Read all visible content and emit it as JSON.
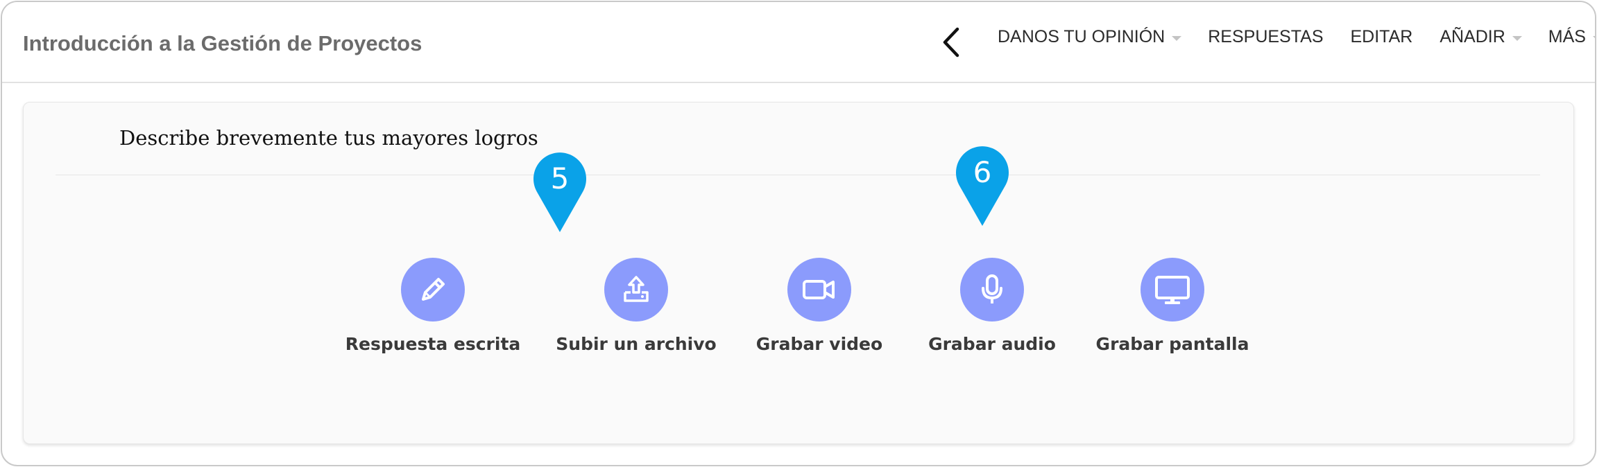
{
  "header": {
    "title": "Introducción a la Gestión de Proyectos",
    "nav": [
      {
        "label": "DANOS TU OPINIÓN",
        "has_dropdown": true
      },
      {
        "label": "RESPUESTAS",
        "has_dropdown": false
      },
      {
        "label": "EDITAR",
        "has_dropdown": false
      },
      {
        "label": "AÑADIR",
        "has_dropdown": true
      },
      {
        "label": "MÁS",
        "has_dropdown": true
      }
    ],
    "back_icon": "chevron-left-icon"
  },
  "question": {
    "text": "Describe brevemente tus mayores logros"
  },
  "response_options": [
    {
      "label": "Respuesta escrita",
      "icon": "pencil-icon"
    },
    {
      "label": "Subir un archivo",
      "icon": "upload-icon"
    },
    {
      "label": "Grabar video",
      "icon": "video-camera-icon"
    },
    {
      "label": "Grabar audio",
      "icon": "microphone-icon"
    },
    {
      "label": "Grabar pantalla",
      "icon": "monitor-icon"
    }
  ],
  "markers": [
    {
      "number": "5"
    },
    {
      "number": "6"
    }
  ],
  "colors": {
    "option_circle": "#8b9bfc",
    "marker": "#0aa2e8",
    "title_text": "#6b6b6b",
    "card_background": "#fafafa"
  }
}
